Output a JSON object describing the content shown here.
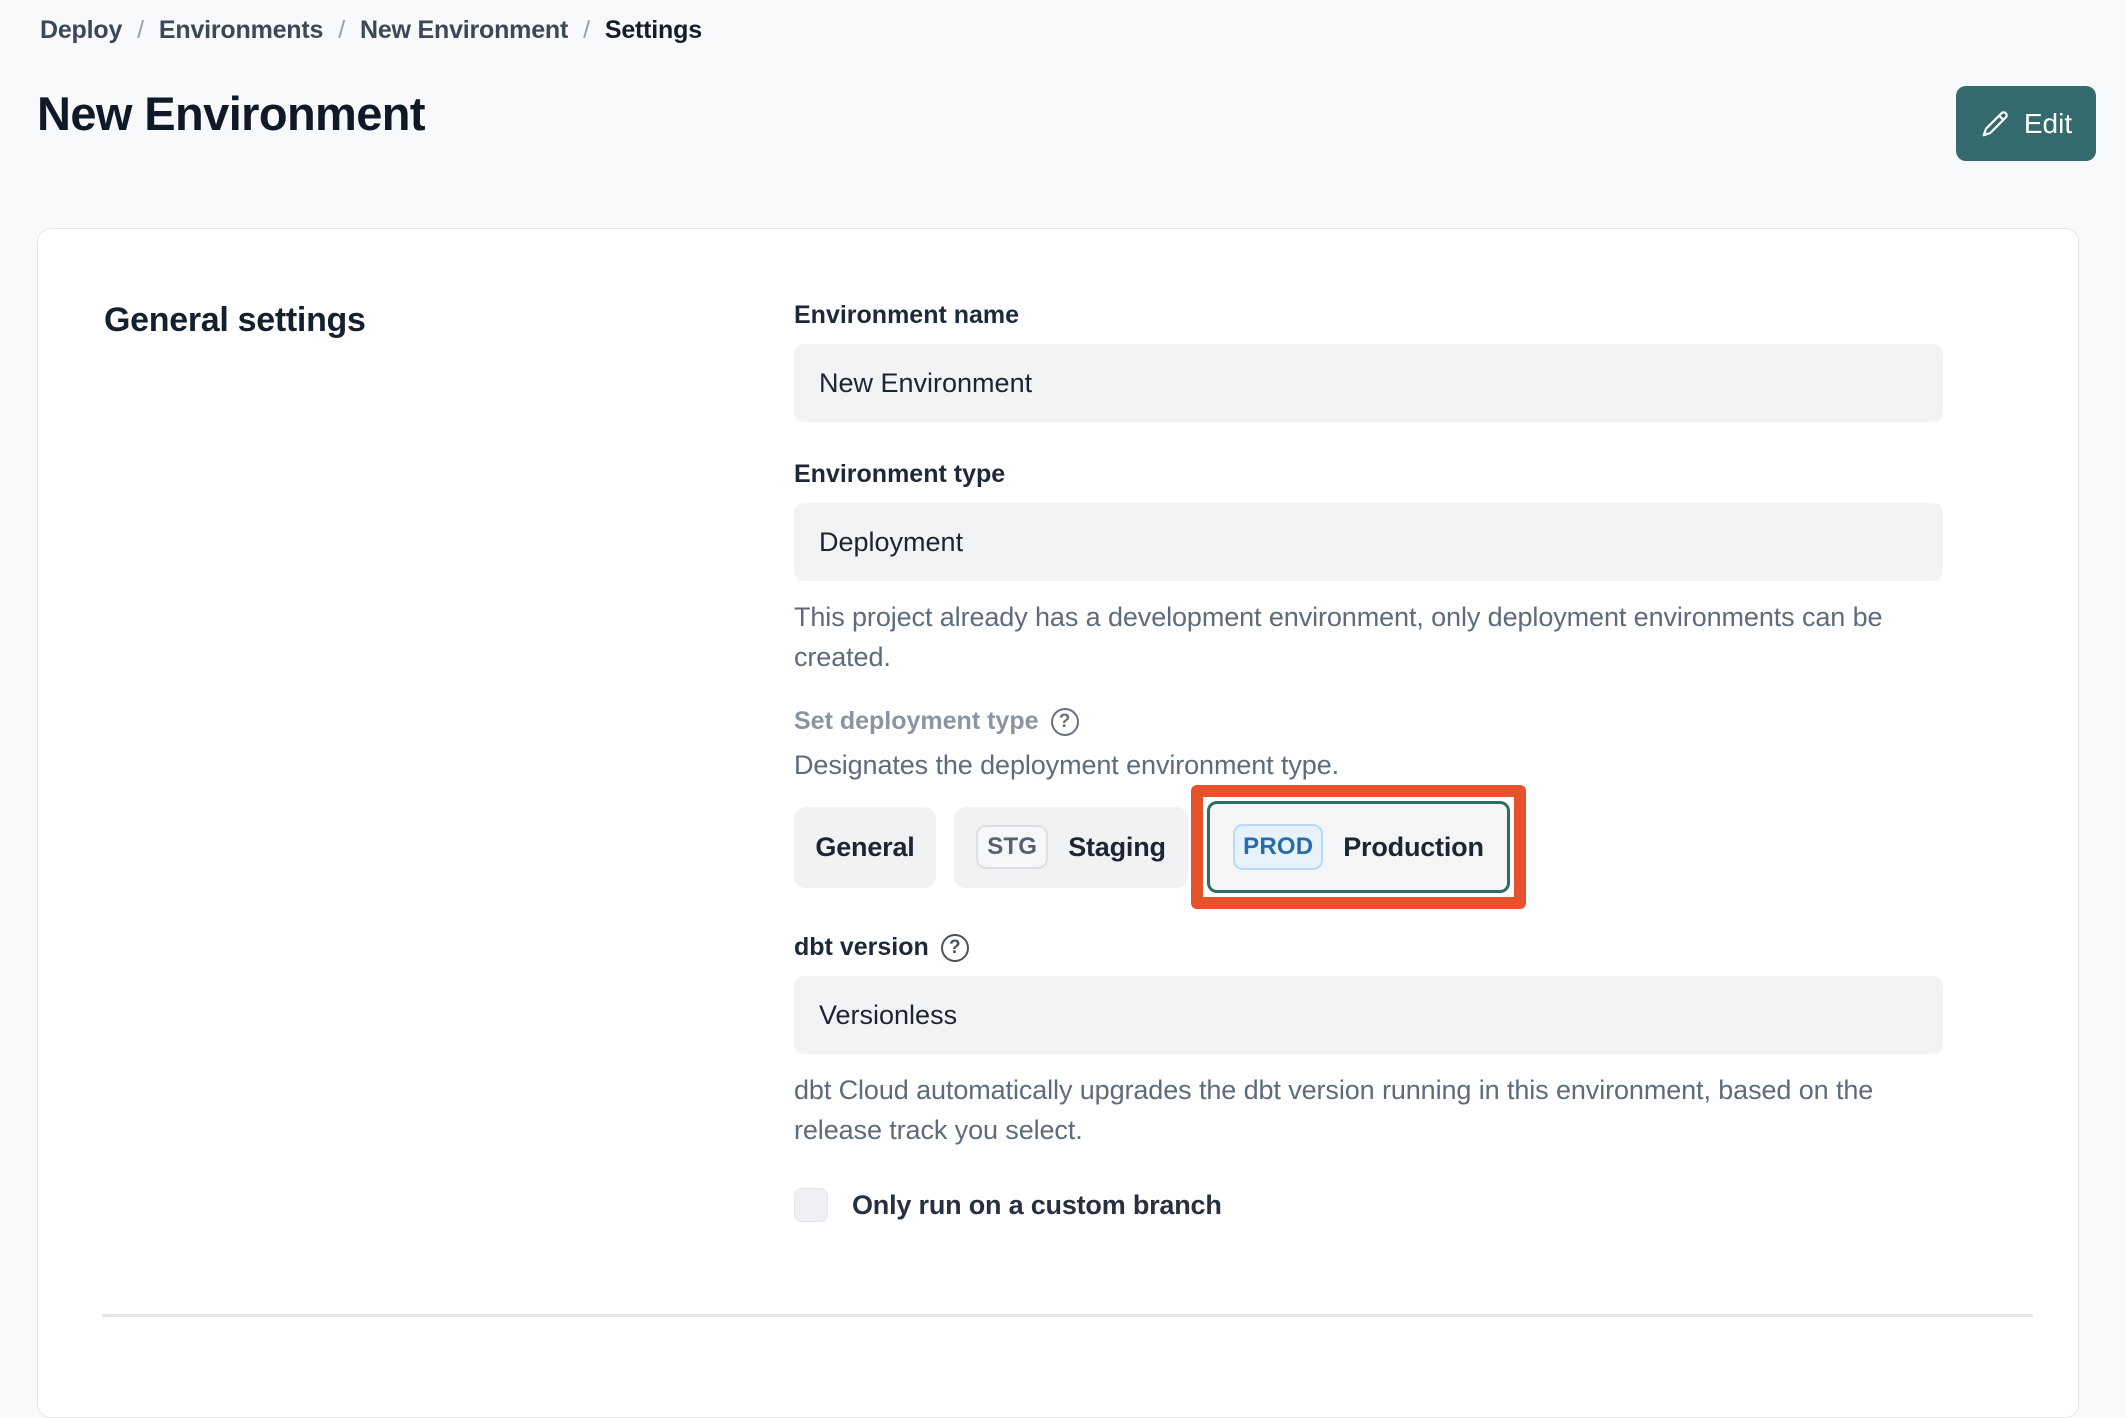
{
  "breadcrumb": {
    "items": [
      "Deploy",
      "Environments",
      "New Environment",
      "Settings"
    ],
    "separator": "/"
  },
  "header": {
    "title": "New Environment",
    "edit_label": "Edit",
    "edit_icon": "pencil"
  },
  "card": {
    "section_title": "General settings",
    "fields": {
      "environment_name": {
        "label": "Environment name",
        "value": "New Environment"
      },
      "environment_type": {
        "label": "Environment type",
        "value": "Deployment",
        "helper": "This project already has a development environment, only deployment environments can be created."
      },
      "deployment_type": {
        "label": "Set deployment type",
        "help_icon": "question-mark-circle",
        "description": "Designates the deployment environment type.",
        "options": [
          {
            "label": "General",
            "badge": "",
            "selected": false
          },
          {
            "label": "Staging",
            "badge": "STG",
            "selected": false
          },
          {
            "label": "Production",
            "badge": "PROD",
            "selected": true,
            "annotated": true
          }
        ]
      },
      "dbt_version": {
        "label": "dbt version",
        "help_icon": "question-mark-circle",
        "value": "Versionless",
        "helper": "dbt Cloud automatically upgrades the dbt version running in this environment, based on the release track you select."
      },
      "custom_branch": {
        "label": "Only run on a custom branch",
        "checked": false
      }
    }
  },
  "colors": {
    "page_bg": "#f8f9fb",
    "card_border": "#e4e7ea",
    "accent_teal": "#346a6d",
    "selected_border_teal": "#2c6e66",
    "annotation_orange": "#e6522c",
    "input_bg": "#f2f3f5",
    "prod_badge_bg": "#e7f2fc",
    "prod_badge_border": "#b9dcf6",
    "prod_badge_text": "#2a6cab",
    "text_dark": "#15202f",
    "text_gray": "#5d6b7a",
    "label_muted": "#8b95a2"
  }
}
